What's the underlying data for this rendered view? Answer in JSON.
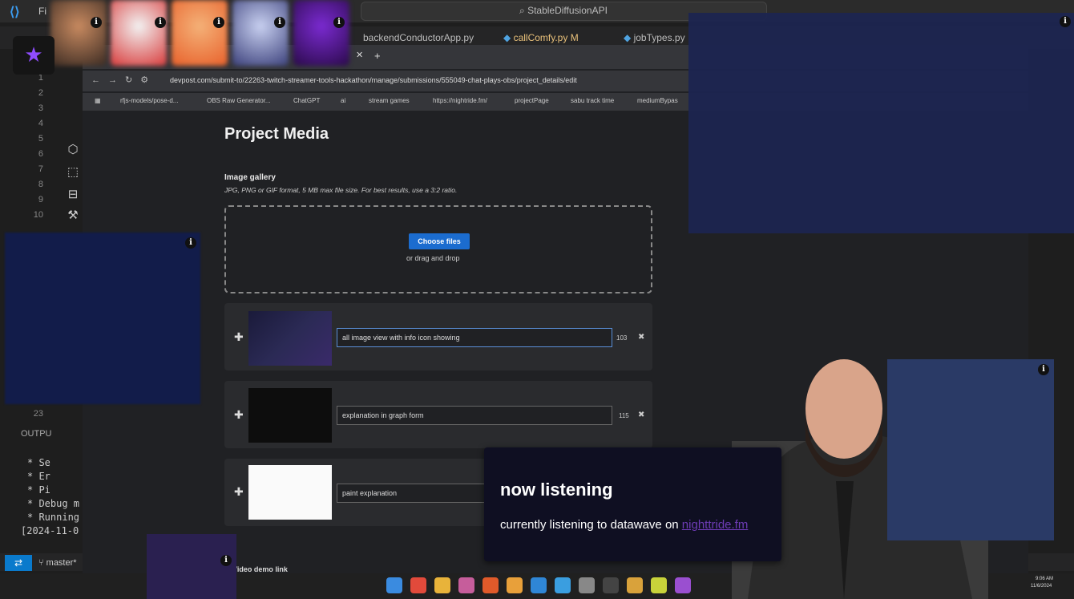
{
  "vscode": {
    "menu_file": "Fi",
    "search_text": "StableDiffusionAPI",
    "tabs": [
      "backendConductorApp.py",
      "callComfy.py M",
      "jobTypes.py"
    ],
    "line_numbers": [
      "1",
      "2",
      "3",
      "4",
      "5",
      "6",
      "7",
      "8",
      "9",
      "10"
    ],
    "bottom_line_number": "23",
    "output_label": "OUTPU",
    "output_lines": [
      "* Se",
      "* Er",
      "* Pi",
      "* Debug m",
      "* Running",
      "[2024-11-0"
    ],
    "branch": "master*"
  },
  "browser": {
    "url": "devpost.com/submit-to/22263-twitch-streamer-tools-hackathon/manage/submissions/555049-chat-plays-obs/project_details/edit",
    "bookmarks": [
      "rfjs-models/pose-d...",
      "OBS Raw Generator...",
      "ChatGPT",
      "ai",
      "stream games",
      "https://nightride.fm/",
      "projectPage",
      "sabu track time",
      "mediumBypas"
    ]
  },
  "devpost": {
    "title": "Project Media",
    "gallery_title": "Image gallery",
    "gallery_desc": "JPG, PNG or GIF format, 5 MB max file size. For best results, use a 3:2 ratio.",
    "choose_files": "Choose files",
    "drag_drop": "or drag and drop",
    "media": [
      {
        "caption": "all image view with info icon showing",
        "count": "103"
      },
      {
        "caption": "explanation in graph form",
        "count": "115"
      },
      {
        "caption": "paint explanation",
        "count": ""
      }
    ],
    "video_label": "Video demo link"
  },
  "overlay": {
    "info_glyph": "i",
    "now_title": "now listening",
    "now_text": "currently listening to datawave on ",
    "now_link": "nighttride.fm"
  },
  "taskbar": {
    "time": "9:06 AM",
    "date": "11/6/2024"
  },
  "colors": {
    "accent_purple": "#8f4cff",
    "button_blue": "#1b6ccf",
    "card_bg": "#0f0f22",
    "link_purple": "#6e3cb6"
  }
}
